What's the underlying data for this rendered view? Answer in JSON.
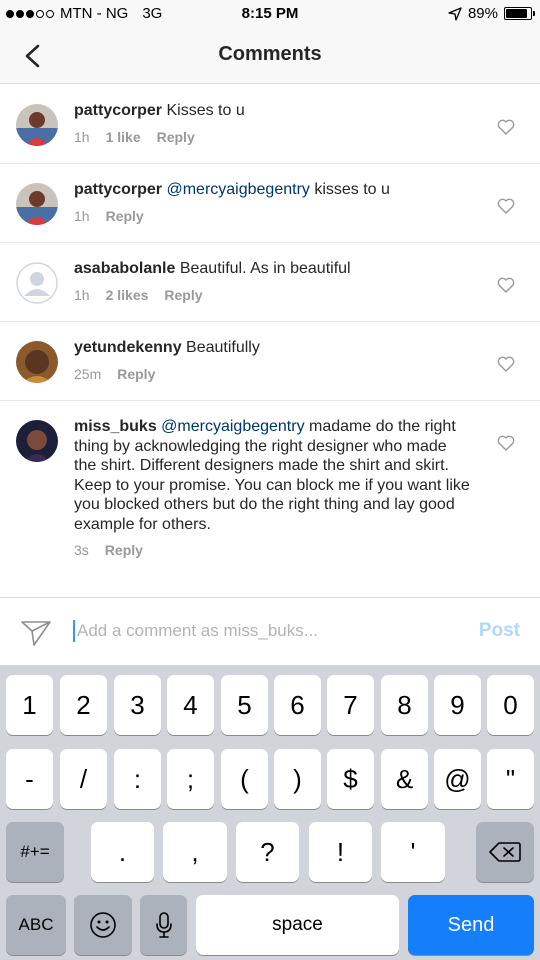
{
  "status_bar": {
    "carrier": "MTN - NG",
    "network": "3G",
    "time": "8:15 PM",
    "battery": "89%",
    "battery_level": 0.89
  },
  "header": {
    "title": "Comments",
    "back_icon": "chevron-left-icon"
  },
  "comments": [
    {
      "username": "pattycorper",
      "mention": "",
      "text": " Kisses to u",
      "time": "1h",
      "likes": "1 like",
      "reply": "Reply"
    },
    {
      "username": "pattycorper",
      "mention": " @mercyaigbegentry",
      "text": " kisses to u",
      "time": "1h",
      "likes": "",
      "reply": "Reply"
    },
    {
      "username": "asababolanle",
      "mention": "",
      "text": " Beautiful.  As in beautiful",
      "time": "1h",
      "likes": "2 likes",
      "reply": "Reply"
    },
    {
      "username": "yetundekenny",
      "mention": "",
      "text": " Beautifully",
      "time": "25m",
      "likes": "",
      "reply": "Reply"
    },
    {
      "username": "miss_buks",
      "mention": " @mercyaigbegentry",
      "text": " madame do the right thing by acknowledging the right designer who made the shirt. Different designers made the shirt and skirt. Keep to your promise. You can block me if you want like you blocked others but do the right thing and lay good example for others.",
      "time": "3s",
      "likes": "",
      "reply": "Reply"
    }
  ],
  "composer": {
    "placeholder": "Add a comment as miss_buks...",
    "post_label": "Post"
  },
  "keyboard": {
    "row1": [
      "1",
      "2",
      "3",
      "4",
      "5",
      "6",
      "7",
      "8",
      "9",
      "0"
    ],
    "row2": [
      "-",
      "/",
      ":",
      ";",
      "(",
      ")",
      "$",
      "&",
      "@",
      "\""
    ],
    "row3_mode": "#+=",
    "row3": [
      ".",
      ",",
      "?",
      "!",
      "'"
    ],
    "abc": "ABC",
    "space": "space",
    "send": "Send"
  },
  "colors": {
    "mention": "#003569",
    "post_disabled": "#b5d7f7",
    "send_key": "#147efb"
  }
}
